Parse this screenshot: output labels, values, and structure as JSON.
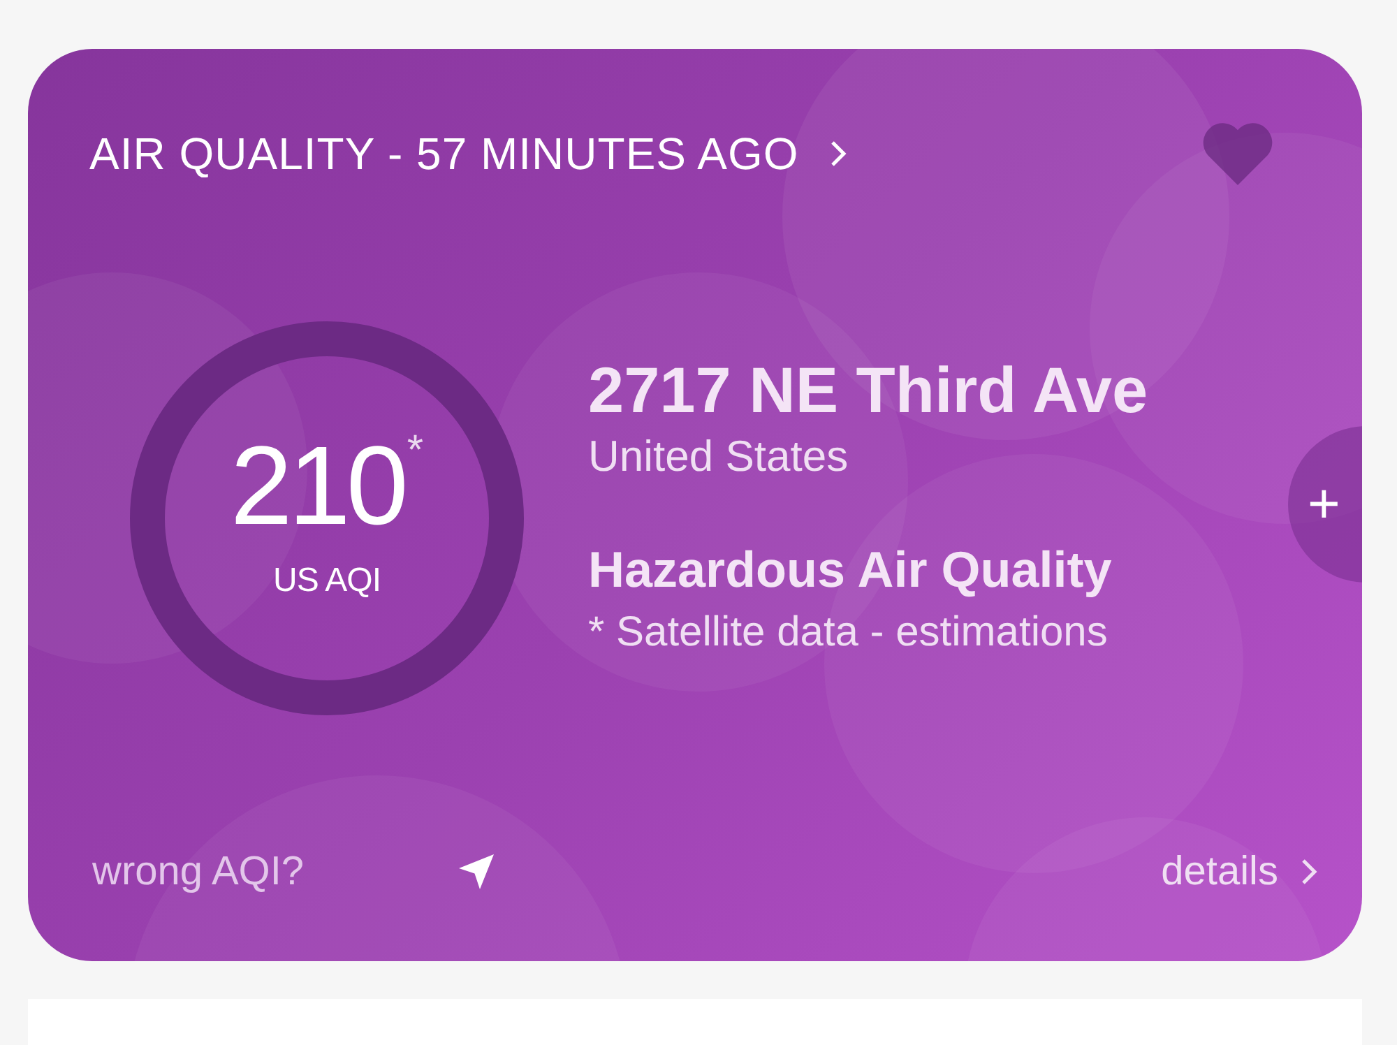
{
  "card": {
    "header": "AIR QUALITY - 57 MINUTES AGO",
    "favorite": false,
    "aqi": {
      "value": "210",
      "mark": "*",
      "unit": "US AQI"
    },
    "location": {
      "street": "2717 NE Third Ave",
      "country": "United States"
    },
    "status": "Hazardous Air Quality",
    "note": "* Satellite data - estimations",
    "add_button": "+",
    "footer": {
      "report_link": "wrong AQI?",
      "details_link": "details"
    }
  }
}
